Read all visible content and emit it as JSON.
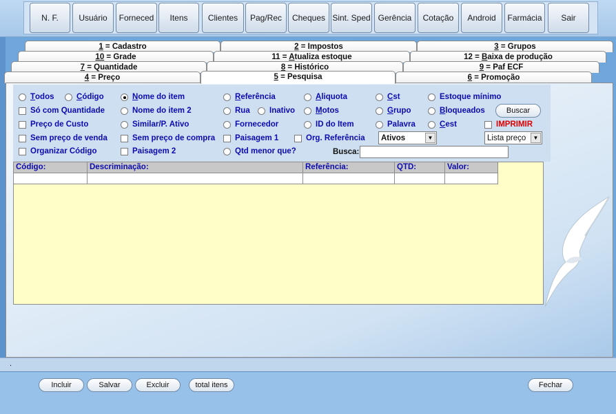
{
  "toolbar": {
    "buttons": [
      "N. F.",
      "Usuário",
      "Forneced",
      "Itens",
      "Clientes",
      "Pag/Rec",
      "Cheques",
      "Sint. Sped",
      "Gerência",
      "Cotação",
      "Android",
      "Farmácia",
      "Sair"
    ]
  },
  "tabs": {
    "row1": [
      {
        "key": "1",
        "label": " = Cadastro"
      },
      {
        "key": "2",
        "label": " = Impostos"
      },
      {
        "key": "3",
        "label": " = Grupos"
      }
    ],
    "row2": [
      {
        "key": "10",
        "label": " = Grade"
      },
      {
        "prefix": "11 = ",
        "key": "A",
        "label": "tualiza estoque"
      },
      {
        "prefix": "12 = ",
        "key": "B",
        "label": "aixa de produção"
      }
    ],
    "row3": [
      {
        "key": "7",
        "label": " = Quantidade"
      },
      {
        "key": "8",
        "label": " = Histórico"
      },
      {
        "key": "9",
        "label": " = Paf ECF"
      }
    ],
    "row4": [
      {
        "key": "4",
        "label": " = Preço"
      },
      {
        "key": "5",
        "label": " = Pesquisa"
      },
      {
        "key": "6",
        "label": " = Promoção"
      }
    ]
  },
  "filters": {
    "todos": {
      "key": "T",
      "rest": "odos"
    },
    "codigo": {
      "key": "C",
      "rest": "ódigo"
    },
    "nome_item": {
      "key": "N",
      "rest": "ome do item"
    },
    "referencia": {
      "key": "R",
      "rest": "eferência"
    },
    "aliquota": {
      "key": "A",
      "rest": "liquota"
    },
    "cst": {
      "key": "C",
      "rest": "st"
    },
    "estoque_minimo": "Estoque mínimo",
    "so_quantidade": "Só com Quantidade",
    "nome_item2": "Nome do item 2",
    "rua": "Rua",
    "inativo": "Inativo",
    "motos": {
      "key": "M",
      "rest": "otos"
    },
    "grupo": {
      "key": "G",
      "rest": "rupo"
    },
    "bloqueados": {
      "key": "B",
      "rest": "loqueados"
    },
    "preco_custo": "Preço de Custo",
    "similar": "Similar/P. Ativo",
    "fornecedor": "Fornecedor",
    "id_item": "ID do Item",
    "palavra": "Palavra",
    "cest": {
      "key": "C",
      "rest": "est"
    },
    "imprimir": "IMPRIMIR",
    "sem_preco_venda": "Sem preço de venda",
    "sem_preco_compra": "Sem preço de compra",
    "paisagem1": "Paisagem 1",
    "org_referencia": "Org. Referência",
    "organizar_codigo": "Organizar Código",
    "paisagem2": "Paisagem 2",
    "qtd_menor": "Qtd menor que?",
    "buscar": "Buscar",
    "status_select": "Ativos",
    "lista_select": "Lista preço",
    "busca_label": "Busca:",
    "busca_value": ""
  },
  "grid": {
    "columns": [
      "Código:",
      "Descriminação:",
      "Referência:",
      "QTD:",
      "Valor:"
    ]
  },
  "footer": {
    "buttons": [
      "Incluir",
      "Salvar",
      "Excluir",
      "total itens"
    ],
    "close": "Fechar",
    "status": "."
  },
  "colors": {
    "label_blue": "#0b0bb0",
    "imprimir_red": "#e00000",
    "grid_bg": "#fffec8"
  }
}
